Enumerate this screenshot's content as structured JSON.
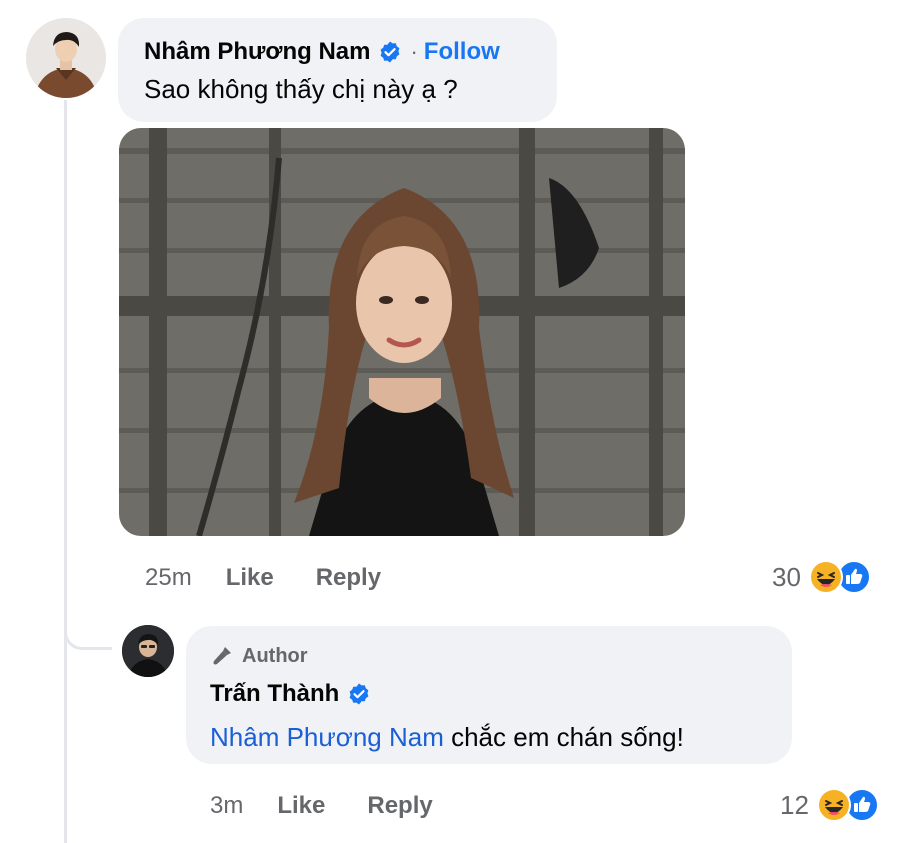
{
  "comment": {
    "author": "Nhâm Phương Nam",
    "separator": "·",
    "follow_label": "Follow",
    "text": "Sao không thấy chị này ạ ?",
    "time": "25m",
    "like_label": "Like",
    "reply_label": "Reply",
    "reaction_count": "30",
    "reactions": [
      "haha-icon",
      "like-icon"
    ]
  },
  "reply": {
    "badge": "Author",
    "author": "Trấn Thành",
    "mention": "Nhâm Phương Nam",
    "text": " chắc em chán sống!",
    "time": "3m",
    "like_label": "Like",
    "reply_label": "Reply",
    "reaction_count": "12",
    "reactions": [
      "haha-icon",
      "like-icon"
    ]
  },
  "colors": {
    "link": "#1877f2",
    "bubble": "#f0f2f5",
    "muted": "#65676b"
  }
}
